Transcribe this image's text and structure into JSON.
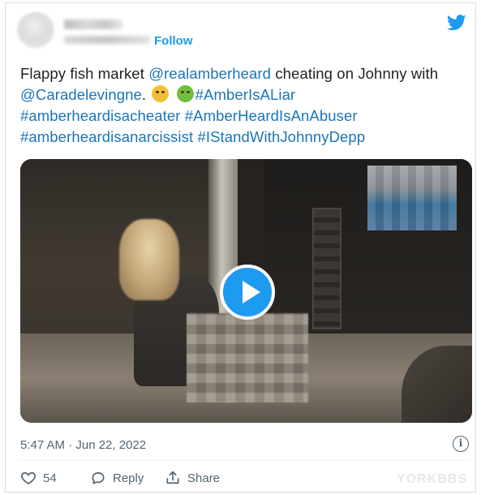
{
  "header": {
    "follow_label": "Follow"
  },
  "tweet": {
    "text_1": "Flappy fish market ",
    "mention_1": "@realamberheard",
    "text_2": " cheating on Johnny with ",
    "mention_2": "@Caradelevingne",
    "text_3": ". ",
    "hashtag_1": "#AmberIsALiar",
    "hashtag_2": "#amberheardisacheater",
    "hashtag_3": "#AmberHeardIsAnAbuser",
    "hashtag_4": "#amberheardisanarcissist",
    "hashtag_5": "#IStandWithJohnnyDepp"
  },
  "timestamp": "5:47 AM · Jun 22, 2022",
  "info_glyph": "i",
  "actions": {
    "like_count": "54",
    "reply_label": "Reply",
    "share_label": "Share"
  },
  "watermark": "YORKBBS",
  "colors": {
    "brand": "#1d9bf0",
    "link": "#1b75b7",
    "muted": "#536471"
  },
  "icons": [
    "twitter-bird-icon",
    "play-icon",
    "info-icon",
    "heart-icon",
    "reply-icon",
    "share-icon"
  ]
}
